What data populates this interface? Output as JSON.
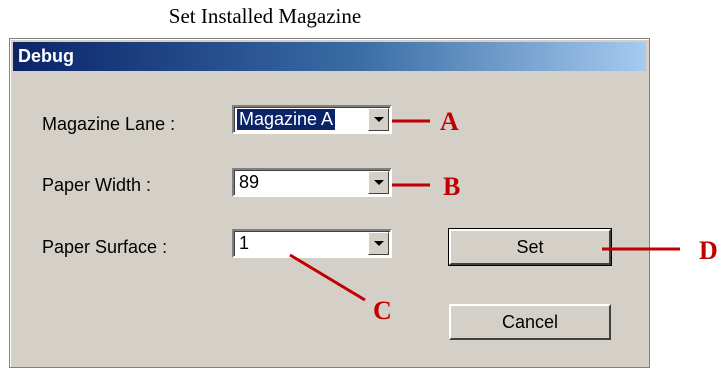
{
  "caption": "Set Installed Magazine",
  "window": {
    "title": "Debug"
  },
  "fields": {
    "magazine_lane": {
      "label": "Magazine Lane :",
      "value": "Magazine A"
    },
    "paper_width": {
      "label": "Paper Width :",
      "value": "89"
    },
    "paper_surface": {
      "label": "Paper Surface :",
      "value": "1"
    }
  },
  "buttons": {
    "set": "Set",
    "cancel": "Cancel"
  },
  "annotations": {
    "a": "A",
    "b": "B",
    "c": "C",
    "d": "D"
  },
  "colors": {
    "annotation": "#c00000",
    "title_start": "#0a246a",
    "title_end": "#a6caf0",
    "dialog_bg": "#d4d0c8"
  }
}
